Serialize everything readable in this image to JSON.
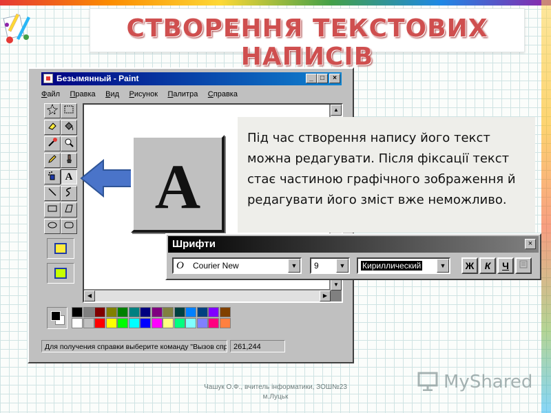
{
  "slide": {
    "title": "СТВОРЕННЯ ТЕКСТОВИХ НАПИСІВ",
    "description": "Під час створення напису його текст можна редагувати. Після фіксації текст стає частиною графічного зображення й редагувати його зміст вже неможливо.",
    "footer": "Чашук О.Ф., вчитель інформатики, ЗОШ№23 м.Луцьк",
    "brand": "MyShared"
  },
  "paint_window": {
    "title": "Безымянный - Paint",
    "menu": [
      "Файл",
      "Правка",
      "Вид",
      "Рисунок",
      "Палитра",
      "Справка"
    ],
    "status_help": "Для получения справки выберите команду \"Вызов справки\"",
    "status_coords": "261,244",
    "title_buttons": {
      "minimize": "_",
      "maximize": "□",
      "close": "×"
    }
  },
  "magnified_tool": {
    "letter": "A"
  },
  "fonts_toolbar": {
    "title": "Шрифти",
    "close": "×",
    "font_name": "Courier New",
    "font_glyph": "O",
    "font_size": "9",
    "script": "Кириллический",
    "bold_label": "Ж",
    "italic_label": "К",
    "underline_label": "Ч"
  },
  "colors": {
    "title_red": "#cf4f4f",
    "win_titlebar": "#000080",
    "arrow_blue": "#4a74c9",
    "palette_row1": [
      "#000000",
      "#808080",
      "#800000",
      "#808000",
      "#008000",
      "#008080",
      "#000080",
      "#800080",
      "#808040",
      "#004040",
      "#0080ff",
      "#004080",
      "#8000ff",
      "#804000"
    ],
    "palette_row2": [
      "#ffffff",
      "#c0c0c0",
      "#ff0000",
      "#ffff00",
      "#00ff00",
      "#00ffff",
      "#0000ff",
      "#ff00ff",
      "#ffff80",
      "#00ff80",
      "#80ffff",
      "#8080ff",
      "#ff0080",
      "#ff8040"
    ]
  },
  "icons": [
    "app-icon",
    "free-select-icon",
    "rect-select-icon",
    "eraser-icon",
    "fill-icon",
    "color-picker-icon",
    "magnifier-icon",
    "pencil-icon",
    "brush-icon",
    "airbrush-icon",
    "text-icon",
    "line-icon",
    "curve-icon",
    "rectangle-icon",
    "polygon-icon",
    "ellipse-icon",
    "rounded-rect-icon",
    "arrow-left-icon"
  ]
}
